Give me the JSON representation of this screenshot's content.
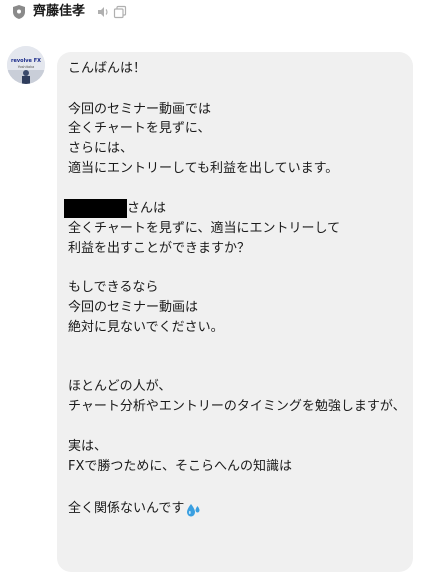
{
  "header": {
    "sender_name": "齊藤佳孝",
    "icons": [
      "shield-icon",
      "speaker-icon",
      "copy-icon"
    ]
  },
  "avatar": {
    "text": "revolve FX",
    "subtext": "Yoshitaka"
  },
  "message": {
    "lines": [
      "こんばんは！",
      "今回のセミナー動画では",
      "全くチャートを見ずに、",
      "さらには、",
      "適当にエントリーしても利益を出しています。",
      "さんは",
      "全くチャートを見ずに、適当にエントリーして",
      "利益を出すことができますか？",
      "もしできるなら",
      "今回のセミナー動画は",
      "絶対に見ないでください。",
      "ほとんどの人が、",
      "チャート分析やエントリーのタイミングを勉強しますが、",
      "実は、",
      "FXで勝つために、そこらへんの知識は",
      "全く関係ないんです"
    ],
    "emoji": "droplet-icon"
  },
  "colors": {
    "bubble": "#f0f0f0",
    "text": "#1a1a1a",
    "droplet": "#3a9fe0"
  }
}
